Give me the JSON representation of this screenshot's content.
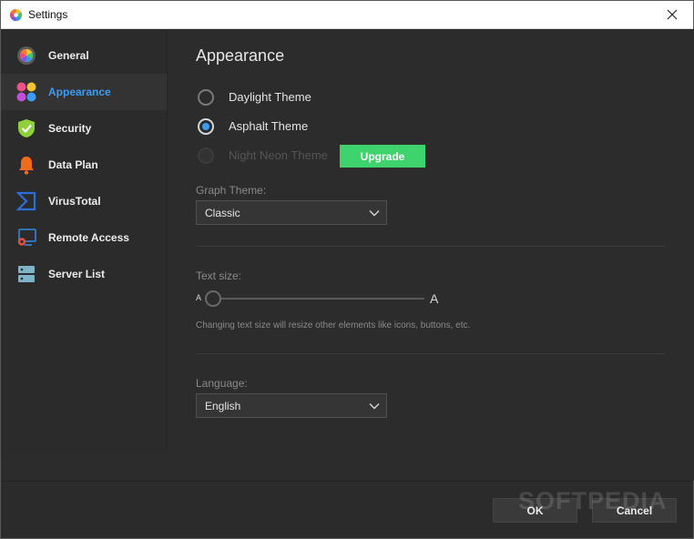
{
  "window": {
    "title": "Settings",
    "app_icon": "color-wheel-icon",
    "close_icon": "close-icon"
  },
  "sidebar": {
    "items": [
      {
        "label": "General",
        "icon": "general-icon",
        "active": false
      },
      {
        "label": "Appearance",
        "icon": "palette-dots-icon",
        "active": true
      },
      {
        "label": "Security",
        "icon": "shield-check-icon",
        "active": false
      },
      {
        "label": "Data Plan",
        "icon": "bell-icon",
        "active": false
      },
      {
        "label": "VirusTotal",
        "icon": "virustotal-icon",
        "active": false
      },
      {
        "label": "Remote Access",
        "icon": "remote-monitor-icon",
        "active": false
      },
      {
        "label": "Server List",
        "icon": "server-icon",
        "active": false
      }
    ]
  },
  "appearance": {
    "heading": "Appearance",
    "themes": [
      {
        "label": "Daylight Theme",
        "selected": false,
        "disabled": false
      },
      {
        "label": "Asphalt Theme",
        "selected": true,
        "disabled": false
      },
      {
        "label": "Night Neon Theme",
        "selected": false,
        "disabled": true
      }
    ],
    "upgrade_label": "Upgrade",
    "graph_theme_label": "Graph Theme:",
    "graph_theme_value": "Classic",
    "text_size_label": "Text size:",
    "text_size_small": "A",
    "text_size_large": "A",
    "text_size_level": 0,
    "text_size_help": "Changing text size will resize other elements like icons, buttons, etc.",
    "language_label": "Language:",
    "language_value": "English"
  },
  "footer": {
    "ok_label": "OK",
    "cancel_label": "Cancel",
    "watermark": "SOFTPEDIA"
  },
  "colors": {
    "accent": "#3b9cf2",
    "upgrade": "#3ed36c",
    "background": "#2c2c2c"
  }
}
